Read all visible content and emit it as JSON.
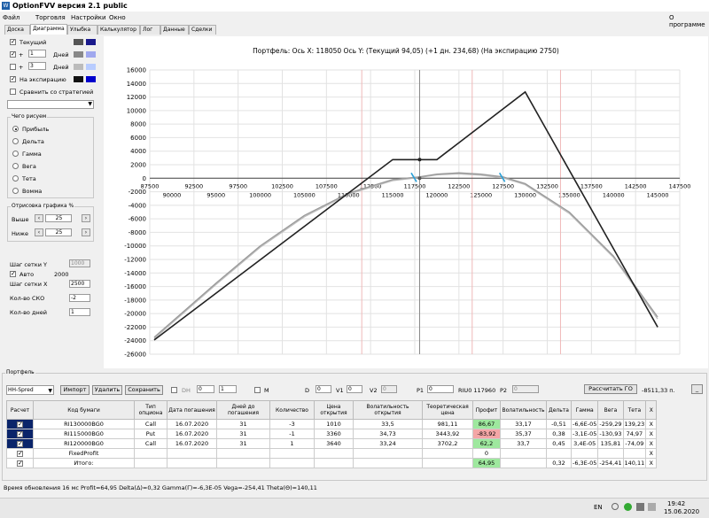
{
  "window": {
    "title": "OptionFVV версия 2.1 public"
  },
  "menu": {
    "items": [
      "Файл",
      "Торговля",
      "Настройки",
      "Окно"
    ],
    "about": "О программе"
  },
  "tabs": [
    "Доска",
    "Диаграмма",
    "Улыбка",
    "Калькулятор",
    "Лог",
    "Данные",
    "Сделки"
  ],
  "left": {
    "current": "Текущий",
    "plus": "+",
    "days1": "1",
    "days2": "3",
    "days_label": "Дней",
    "expiration": "На экспирацию",
    "compare": "Сравнить со стратегией",
    "what_title": "Чего рисуем",
    "radios": [
      "Прибыль",
      "Дельта",
      "Гамма",
      "Вега",
      "Тета",
      "Вомма"
    ],
    "render_title": "Отрисовка графика %",
    "above": "Выше",
    "below": "Ниже",
    "above_val": "25",
    "below_val": "25",
    "grid_y": "Шаг сетки Y",
    "grid_y_val": "1000",
    "auto": "Авто",
    "auto_val": "2000",
    "grid_x": "Шаг сетки X",
    "grid_x_val": "2500",
    "sko": "Кол-во СКО",
    "sko_val": "-2",
    "days_count": "Кол-во дней",
    "days_count_val": "1",
    "colors": [
      "#555555",
      "#1a1a8c",
      "#888888",
      "#a0a8ee",
      "#bbbbbb",
      "#b8ccff",
      "#111111",
      "#0000cc"
    ]
  },
  "chart_data": {
    "type": "line",
    "title": "Портфель: Ось X: 118050 Ось Y:  (Текущий 94,05)  (+1 дн. 234,68)  (На экспирацию 2750)",
    "xlim": [
      87500,
      147500
    ],
    "ylim": [
      -26000,
      16000
    ],
    "x_ticks_top": [
      87500,
      92500,
      97500,
      102500,
      107500,
      112500,
      117500,
      122500,
      127500,
      132500,
      137500,
      142500,
      147500
    ],
    "x_ticks_bottom": [
      90000,
      95000,
      100000,
      105000,
      110000,
      115000,
      120000,
      125000,
      130000,
      135000,
      140000,
      145000
    ],
    "y_ticks": [
      16000,
      14000,
      12000,
      10000,
      8000,
      6000,
      4000,
      2000,
      0,
      -2000,
      -4000,
      -6000,
      -8000,
      -10000,
      -12000,
      -14000,
      -16000,
      -18000,
      -20000,
      -22000,
      -24000,
      -26000
    ],
    "current_x": 118050,
    "series": [
      {
        "color": "#222222",
        "x": [
          88000,
          115000,
          117500,
          120000,
          130000,
          145000
        ],
        "y": [
          -23900,
          2750,
          2750,
          2750,
          12750,
          -22000
        ]
      },
      {
        "color": "#999999",
        "x": [
          88000,
          95000,
          100000,
          105000,
          110000,
          115000,
          118000,
          120000,
          122500,
          125000,
          127500,
          130000,
          135000,
          140000,
          145000
        ],
        "y": [
          -23500,
          -15500,
          -10000,
          -5500,
          -2200,
          -200,
          200,
          600,
          800,
          600,
          200,
          -800,
          -5000,
          -11500,
          -20500
        ]
      },
      {
        "color": "#bbbbbb",
        "x": [
          88000,
          95000,
          100000,
          105000,
          110000,
          115000,
          118000,
          120000,
          122500,
          125000,
          127500,
          130000,
          135000,
          140000,
          145000
        ],
        "y": [
          -23700,
          -15700,
          -10200,
          -5700,
          -2350,
          -350,
          100,
          500,
          650,
          450,
          50,
          -950,
          -5200,
          -11700,
          -20800
        ]
      }
    ],
    "sd_lines": [
      111500,
      124000,
      134000
    ],
    "markers": [
      117500,
      127500
    ]
  },
  "portfolio": {
    "title": "Портфель",
    "strategy": "HH-Spred",
    "import": "Импорт",
    "delete": "Удалить",
    "save": "Сохранить",
    "dh": "DH",
    "dh_val": "0",
    "dh_val2": "1",
    "m": "M",
    "d": "D",
    "d_val": "0",
    "v1": "V1",
    "v1_val": "0",
    "v2": "V2",
    "v2_val": "0",
    "p1": "P1",
    "p1_val": "0",
    "p2_label": "RIU0 117960",
    "p2": "P2",
    "p2_val": "0",
    "calc_go": "Рассчитать ГО",
    "go_value": "-8511,33 п.",
    "columns": [
      "Расчет",
      "Код бумаги",
      "Тип опциона",
      "Дата погашения",
      "Дней до погашения",
      "Количество",
      "Цена открытия",
      "Волатильность открытия",
      "Теоретическая цена",
      "Профит",
      "Волатильность",
      "Дельта",
      "Гамма",
      "Вега",
      "Тета",
      "X"
    ],
    "rows": [
      [
        "RI130000BG0",
        "Call",
        "16.07.2020",
        "31",
        "-3",
        "1010",
        "33,5",
        "981,11",
        "86,67",
        "33,17",
        "-0,51",
        "-6,6E-05",
        "-259,29",
        "139,23",
        "X"
      ],
      [
        "RI115000BG0",
        "Put",
        "16.07.2020",
        "31",
        "-1",
        "3360",
        "34,73",
        "3443,92",
        "-83,92",
        "35,37",
        "0,38",
        "-3,1E-05",
        "-130,93",
        "74,97",
        "X"
      ],
      [
        "RI120000BG0",
        "Call",
        "16.07.2020",
        "31",
        "1",
        "3640",
        "33,24",
        "3702,2",
        "62,2",
        "33,7",
        "0,45",
        "3,4E-05",
        "135,81",
        "-74,09",
        "X"
      ],
      [
        "FixedProfit",
        "",
        "",
        "",
        "",
        "",
        "",
        "",
        "0",
        "",
        "",
        "",
        "",
        "",
        "X"
      ],
      [
        "Итого:",
        "",
        "",
        "",
        "",
        "",
        "",
        "",
        "64,95",
        "",
        "0,32",
        "-6,3E-05",
        "-254,41",
        "140,11",
        "X"
      ]
    ]
  },
  "status": "Время обновления 16 мс  Profit=64,95 Delta(Δ)=0,32 Gamma(Γ)=-6,3E-05 Vega=-254,41 Theta(Θ)=140,11",
  "taskbar": {
    "lang": "EN",
    "time": "19:42",
    "date": "15.06.2020"
  }
}
